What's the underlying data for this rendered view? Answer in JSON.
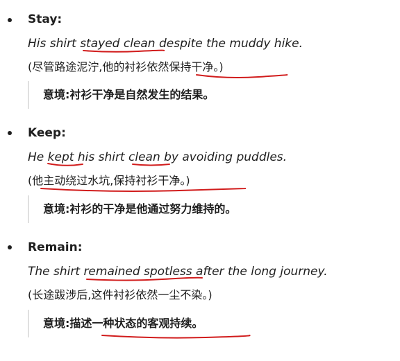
{
  "entries": [
    {
      "term": "Stay",
      "colon": ":",
      "example": {
        "pre": "His shirt ",
        "hl1": "stayed clean",
        "mid": " despite the muddy hike."
      },
      "translation": {
        "pre": "(尽管路途泥泞,他的衬衫",
        "hl": "依然保持干净。",
        "post": ")"
      },
      "note": "意境:衬衫干净是自然发生的结果。"
    },
    {
      "term": "Keep",
      "colon": ":",
      "example": {
        "pre": "He ",
        "hl1": "kept",
        "mid": " his shirt ",
        "hl2": "clean",
        "post": " by avoiding puddles."
      },
      "translation": {
        "pre": "(",
        "hl": "他主动绕过水坑,保持衬衫干净。",
        "post": ")"
      },
      "note": "意境:衬衫的干净是他通过努力维持的。"
    },
    {
      "term": "Remain",
      "colon": ":",
      "example": {
        "pre": "The shirt ",
        "hl1": "remained spotless",
        "mid": " after the long journey."
      },
      "translation": {
        "text": "(长途跋涉后,这件衬衫依然一尘不染。)"
      },
      "note": {
        "pre": "意境:描述",
        "hl": "一种状态的客观持续。"
      }
    }
  ],
  "colors": {
    "annotation": "#d11c1c",
    "quote_bar": "#e0e0e0",
    "text": "#1f1f1f"
  }
}
